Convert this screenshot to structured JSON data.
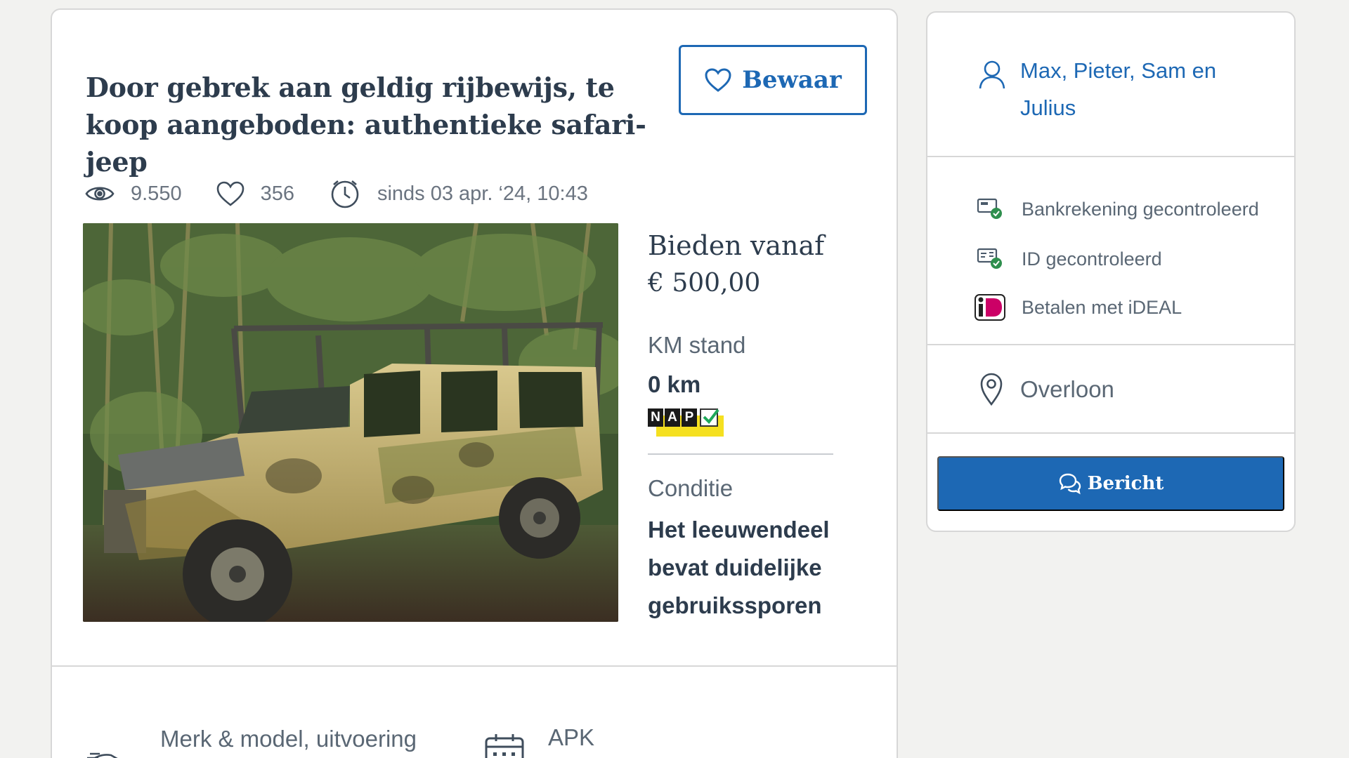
{
  "listing": {
    "title": "Door gebrek aan geldig rijbewijs, te koop aangeboden:  authentieke safari-jeep",
    "save_label": "Bewaar",
    "views": "9.550",
    "favorites": "356",
    "since": "sinds 03 apr. ‘24, 10:43",
    "bid_label": "Bieden vanaf",
    "bid_price": "€ 500,00",
    "km_label": "KM stand",
    "km_value": "0 km",
    "nap": [
      "N",
      "A",
      "P"
    ],
    "condition_label": "Conditie",
    "condition_value": "Het leeuwendeel bevat duidelijke gebruikssporen",
    "specs": {
      "brand_label": "Merk & model, uitvoering",
      "apk_label": "APK"
    }
  },
  "seller": {
    "name": "Max, Pieter, Sam en Julius",
    "verifications": [
      "Bankrekening gecontroleerd",
      "ID gecontroleerd",
      "Betalen met iDEAL"
    ],
    "location": "Overloon",
    "message_label": "Bericht"
  },
  "icons": {
    "views": "eye-icon",
    "favorites": "heart-icon",
    "since": "clock-icon",
    "seller": "user-icon",
    "location": "map-pin-icon",
    "message": "chat-bubbles-icon"
  },
  "colors": {
    "accent": "#1d68b4",
    "text": "#2d3c4d",
    "muted": "#5a6774",
    "verified": "#2f8f4e",
    "ideal": "#cc0066"
  }
}
